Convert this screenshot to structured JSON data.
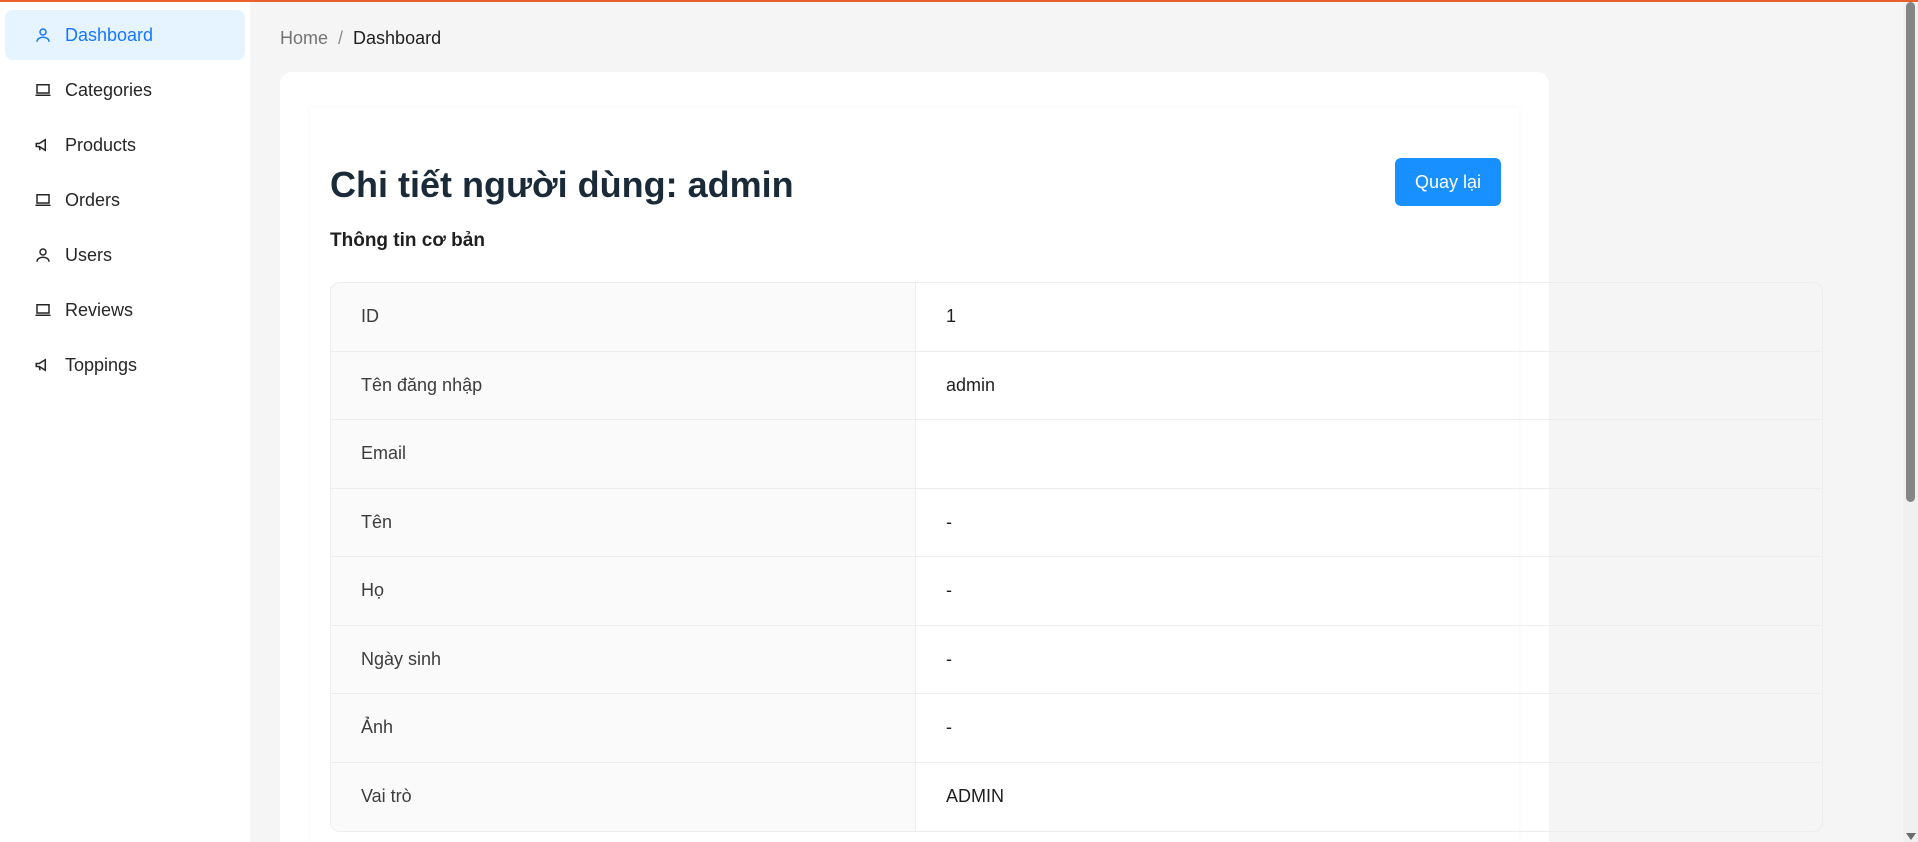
{
  "sidebar": {
    "items": [
      {
        "label": "Dashboard",
        "icon": "user-icon",
        "active": true
      },
      {
        "label": "Categories",
        "icon": "laptop-icon",
        "active": false
      },
      {
        "label": "Products",
        "icon": "megaphone-icon",
        "active": false
      },
      {
        "label": "Orders",
        "icon": "laptop-icon",
        "active": false
      },
      {
        "label": "Users",
        "icon": "user-icon",
        "active": false
      },
      {
        "label": "Reviews",
        "icon": "laptop-icon",
        "active": false
      },
      {
        "label": "Toppings",
        "icon": "megaphone-icon",
        "active": false
      }
    ]
  },
  "breadcrumb": {
    "home": "Home",
    "separator": "/",
    "current": "Dashboard"
  },
  "page": {
    "title": "Chi tiết người dùng: admin",
    "back_button": "Quay lại",
    "section_title": "Thông tin cơ bản"
  },
  "details": [
    {
      "label": "ID",
      "value": "1"
    },
    {
      "label": "Tên đăng nhập",
      "value": "admin"
    },
    {
      "label": "Email",
      "value": ""
    },
    {
      "label": "Tên",
      "value": "-"
    },
    {
      "label": "Họ",
      "value": "-"
    },
    {
      "label": "Ngày sinh",
      "value": "-"
    },
    {
      "label": "Ảnh",
      "value": "-"
    },
    {
      "label": "Vai trò",
      "value": "ADMIN"
    }
  ],
  "colors": {
    "accent": "#1677ff",
    "primary_button": "#1890ff",
    "active_menu_bg": "#e6f4ff",
    "top_accent": "#e8622c"
  }
}
